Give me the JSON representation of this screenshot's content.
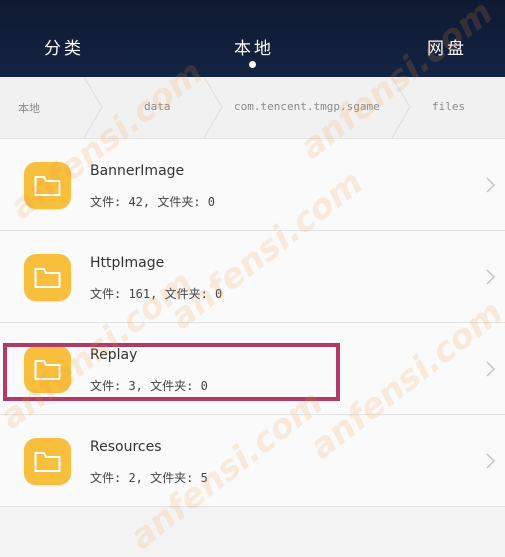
{
  "header": {
    "tabs": [
      {
        "label": "分类"
      },
      {
        "label": "本地"
      },
      {
        "label": "网盘"
      }
    ]
  },
  "breadcrumb": {
    "items": [
      {
        "label": "本地"
      },
      {
        "label": "data"
      },
      {
        "label": "com.tencent.tmgp.sgame"
      },
      {
        "label": "files"
      }
    ]
  },
  "folders": [
    {
      "name": "BannerImage",
      "info": "文件: 42, 文件夹: 0"
    },
    {
      "name": "HttpImage",
      "info": "文件: 161, 文件夹: 0"
    },
    {
      "name": "Replay",
      "info": "文件: 3, 文件夹: 0"
    },
    {
      "name": "Resources",
      "info": "文件: 2, 文件夹: 5"
    }
  ],
  "watermark": "anfensi.com",
  "colors": {
    "header_bg": "#132342",
    "folder_icon": "#f7bf3c",
    "highlight_border": "#b23a67"
  },
  "icons": {
    "folder": "folder-icon",
    "chevron": "chevron-right-icon"
  }
}
